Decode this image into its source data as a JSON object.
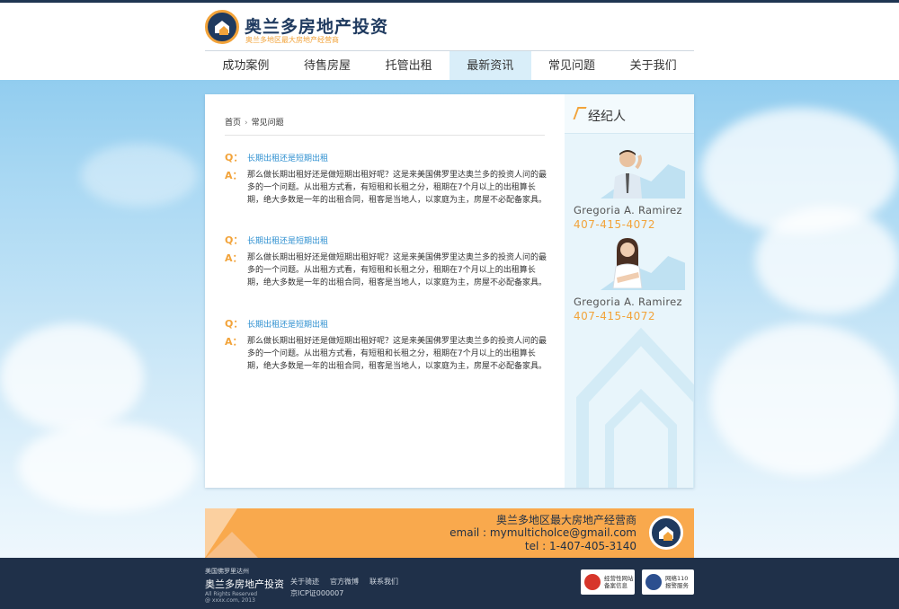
{
  "header": {
    "logo_title": "奥兰多房地产投资",
    "logo_subtitle": "奥兰多地区最大房地产经营商"
  },
  "nav": {
    "items": [
      {
        "label": "成功案例"
      },
      {
        "label": "待售房屋"
      },
      {
        "label": "托管出租"
      },
      {
        "label": "最新资讯",
        "active": true
      },
      {
        "label": "常见问题"
      },
      {
        "label": "关于我们"
      }
    ]
  },
  "breadcrumb": {
    "home": "首页",
    "current": "常见问题"
  },
  "faq": {
    "q_marker": "Q：",
    "a_marker": "A：",
    "items": [
      {
        "question": "长期出租还是短期出租",
        "answer": "那么做长期出租好还是做短期出租好呢？这是来美国佛罗里达奥兰多的投资人问的最多的一个问题。从出租方式看，有短租和长租之分，租期在7个月以上的出租算长期，绝大多数是一年的出租合同，租客是当地人，以家庭为主，房屋不必配备家具。"
      },
      {
        "question": "长期出租还是短期出租",
        "answer": "那么做长期出租好还是做短期出租好呢？这是来美国佛罗里达奥兰多的投资人问的最多的一个问题。从出租方式看，有短租和长租之分，租期在7个月以上的出租算长期，绝大多数是一年的出租合同，租客是当地人，以家庭为主，房屋不必配备家具。"
      },
      {
        "question": "长期出租还是短期出租",
        "answer": "那么做长期出租好还是做短期出租好呢？这是来美国佛罗里达奥兰多的投资人问的最多的一个问题。从出租方式看，有短租和长租之分，租期在7个月以上的出租算长期，绝大多数是一年的出租合同，租客是当地人，以家庭为主，房屋不必配备家具。"
      }
    ]
  },
  "sidebar": {
    "title": "经纪人",
    "agents": [
      {
        "name": "Gregoria A. Ramirez",
        "phone": "407-415-4072"
      },
      {
        "name": "Gregoria A. Ramirez",
        "phone": "407-415-4072"
      }
    ]
  },
  "banner": {
    "line1": "奥兰多地区最大房地产经营商",
    "line2": "email : mymulticholce@gmail.com",
    "line3": "tel : 1-407-405-3140"
  },
  "footer": {
    "brand_small": "美国佛罗里达州",
    "brand_name": "奥兰多房地产投资",
    "rights": "All Rights Reserved",
    "copyright": "@ xxxx.com, 2013",
    "links": [
      "关于骑迹",
      "官方微博",
      "联系我们"
    ],
    "icp": "京ICP证000007",
    "badge1": {
      "line1": "经营性网站",
      "line2": "备案信息"
    },
    "badge2": {
      "line1": "网络110",
      "line2": "报警服务"
    }
  },
  "colors": {
    "accent_orange": "#f2a33a",
    "navy": "#1f3a5f",
    "link_blue": "#2d8fd0",
    "sky": "#a9d8f3"
  }
}
